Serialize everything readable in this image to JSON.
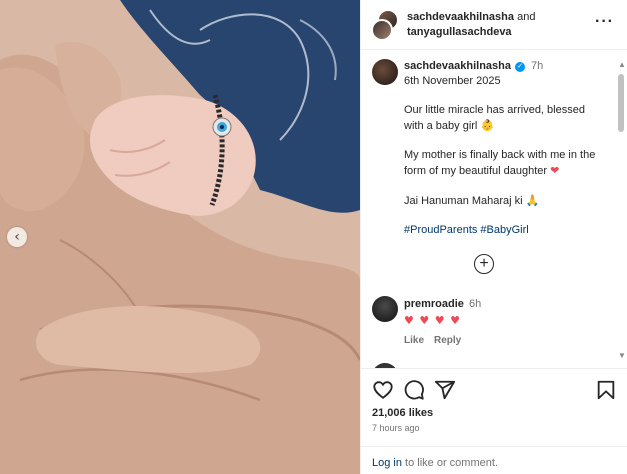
{
  "header": {
    "user1": "sachdevaakhilnasha",
    "joiner": "and",
    "user2": "tanyagullasachdeva"
  },
  "caption": {
    "handle": "sachdevaakhilnasha",
    "time": "7h",
    "date": "6th November 2025",
    "line1": "Our little miracle has arrived, blessed with a baby girl",
    "line1_emoji": "👶",
    "line2": "My mother is finally back with me in the form of my beautiful daughter",
    "line2_emoji": "❤",
    "line3": "Jai Hanuman Maharaj ki",
    "line3_emoji": "🙏",
    "hashtags": "#ProudParents #BabyGirl"
  },
  "comment": {
    "handle": "premroadie",
    "time": "6h",
    "hearts": "♥ ♥ ♥ ♥",
    "like_label": "Like",
    "reply_label": "Reply"
  },
  "actions": {
    "likes": "21,006 likes",
    "posted": "7 hours ago",
    "login_link": "Log in",
    "login_rest": " to like or comment."
  },
  "icons": {
    "more": "more-options-icon",
    "like": "heart-icon",
    "comment": "comment-icon",
    "share": "share-icon",
    "save": "bookmark-icon",
    "prev": "chevron-left-icon",
    "add": "plus-circle-icon"
  },
  "colors": {
    "link": "#00376b",
    "verified": "#0095f6",
    "heart": "#ed4956"
  }
}
